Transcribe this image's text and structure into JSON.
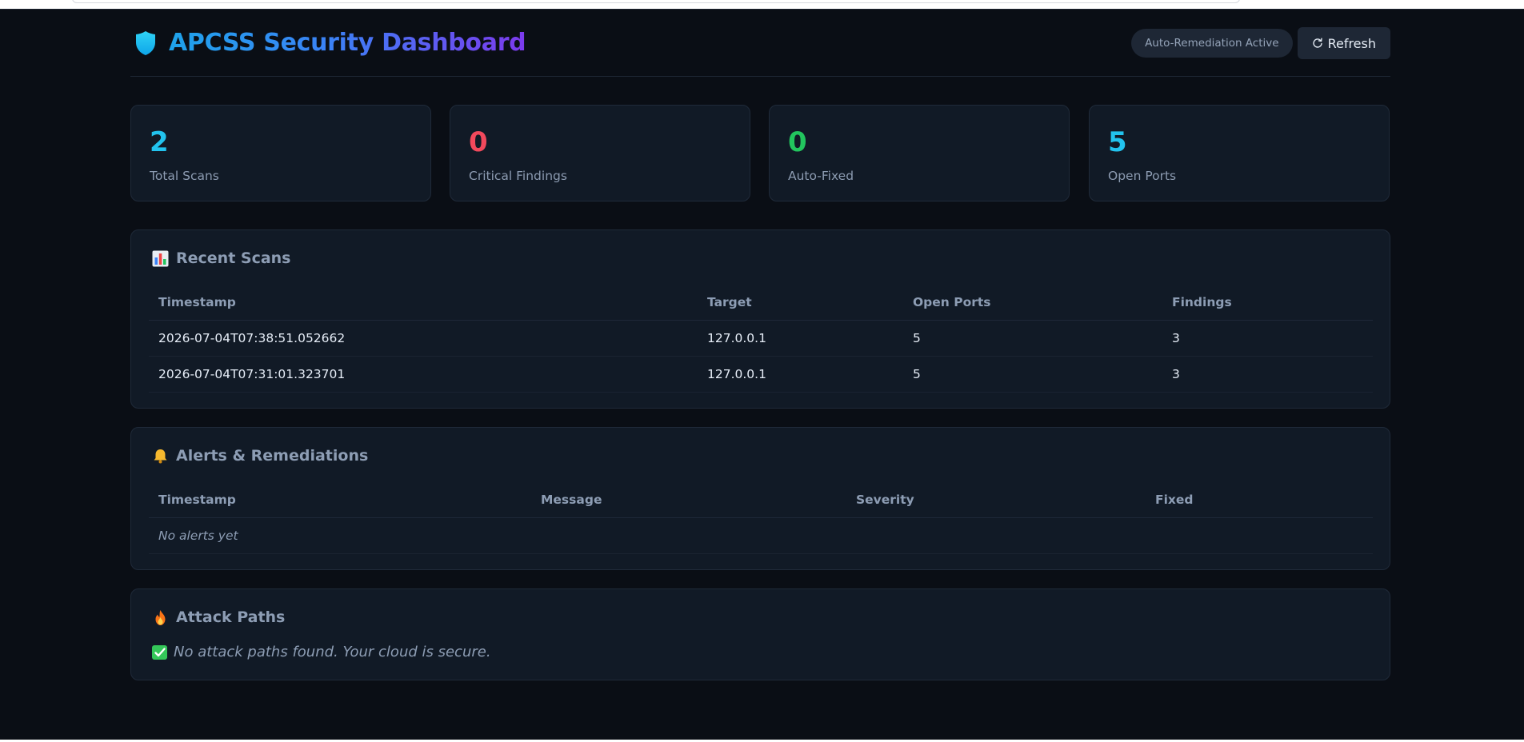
{
  "header": {
    "title": "APCSS Security Dashboard",
    "status_badge": "Auto-Remediation Active",
    "refresh_label": "Refresh"
  },
  "stats": [
    {
      "value": "2",
      "label": "Total Scans",
      "color": "#22c3ee"
    },
    {
      "value": "0",
      "label": "Critical Findings",
      "color": "#f2495c"
    },
    {
      "value": "0",
      "label": "Auto-Fixed",
      "color": "#22c55e"
    },
    {
      "value": "5",
      "label": "Open Ports",
      "color": "#22c3ee"
    }
  ],
  "recent_scans": {
    "title": "Recent Scans",
    "icon": "bar-chart-icon",
    "columns": [
      "Timestamp",
      "Target",
      "Open Ports",
      "Findings"
    ],
    "rows": [
      [
        "2026-07-04T07:38:51.052662",
        "127.0.0.1",
        "5",
        "3"
      ],
      [
        "2026-07-04T07:31:01.323701",
        "127.0.0.1",
        "5",
        "3"
      ]
    ]
  },
  "alerts": {
    "title": "Alerts & Remediations",
    "icon": "bell-icon",
    "columns": [
      "Timestamp",
      "Message",
      "Severity",
      "Fixed"
    ],
    "empty_text": "No alerts yet"
  },
  "attack_paths": {
    "title": "Attack Paths",
    "icon": "fire-icon",
    "message": "No attack paths found. Your cloud is secure."
  },
  "colors": {
    "background": "#0a0e15",
    "card": "#111a26",
    "accent_cyan": "#22c3ee",
    "critical_red": "#f2495c",
    "success_green": "#22c55e"
  }
}
